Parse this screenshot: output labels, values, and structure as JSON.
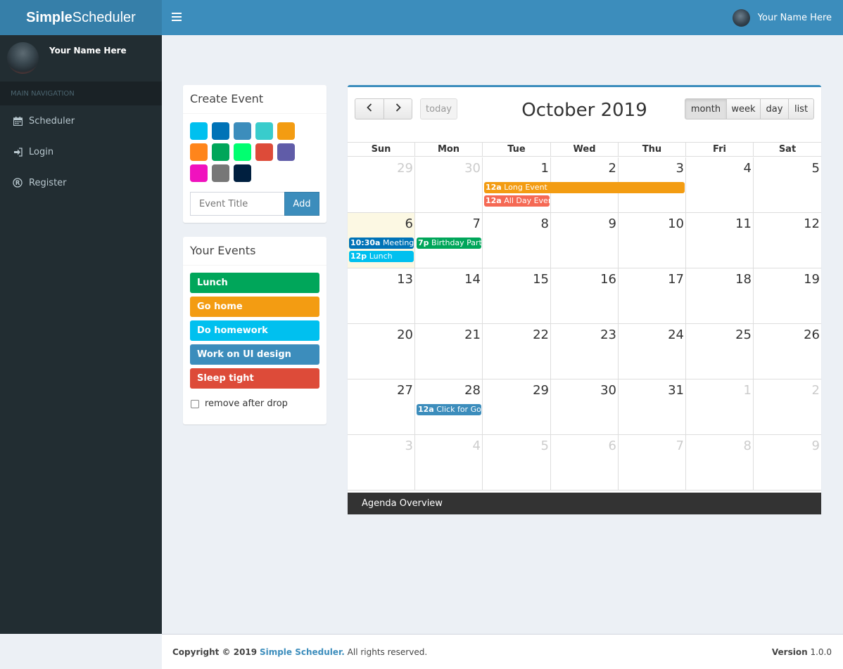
{
  "header": {
    "logo_bold": "Simple",
    "logo_rest": "Scheduler",
    "user_name": "Your Name Here"
  },
  "sidebar": {
    "user_name": "Your Name Here",
    "nav_header": "MAIN NAVIGATION",
    "items": [
      {
        "label": "Scheduler",
        "icon": "calendar-icon"
      },
      {
        "label": "Login",
        "icon": "sign-in-icon"
      },
      {
        "label": "Register",
        "icon": "registered-icon"
      }
    ]
  },
  "create_event": {
    "title": "Create Event",
    "colors": [
      "#00c0ef",
      "#0073b7",
      "#3c8dbc",
      "#39cccc",
      "#f39c12",
      "#ff851b",
      "#00a65a",
      "#01ff70",
      "#dd4b39",
      "#605ca8",
      "#f012be",
      "#777777",
      "#001f3f"
    ],
    "input_placeholder": "Event Title",
    "add_label": "Add"
  },
  "your_events": {
    "title": "Your Events",
    "items": [
      {
        "label": "Lunch",
        "color": "#00a65a"
      },
      {
        "label": "Go home",
        "color": "#f39c12"
      },
      {
        "label": "Do homework",
        "color": "#00c0ef"
      },
      {
        "label": "Work on UI design",
        "color": "#3c8dbc"
      },
      {
        "label": "Sleep tight",
        "color": "#dd4b39"
      }
    ],
    "remove_label": "remove after drop"
  },
  "calendar": {
    "title": "October 2019",
    "today_label": "today",
    "views": [
      "month",
      "week",
      "day",
      "list"
    ],
    "active_view": "month",
    "days_of_week": [
      "Sun",
      "Mon",
      "Tue",
      "Wed",
      "Thu",
      "Fri",
      "Sat"
    ],
    "weeks": [
      [
        {
          "n": "29",
          "o": true
        },
        {
          "n": "30",
          "o": true
        },
        {
          "n": "1"
        },
        {
          "n": "2"
        },
        {
          "n": "3"
        },
        {
          "n": "4"
        },
        {
          "n": "5"
        }
      ],
      [
        {
          "n": "6",
          "today": true
        },
        {
          "n": "7"
        },
        {
          "n": "8"
        },
        {
          "n": "9"
        },
        {
          "n": "10"
        },
        {
          "n": "11"
        },
        {
          "n": "12"
        }
      ],
      [
        {
          "n": "13"
        },
        {
          "n": "14"
        },
        {
          "n": "15"
        },
        {
          "n": "16"
        },
        {
          "n": "17"
        },
        {
          "n": "18"
        },
        {
          "n": "19"
        }
      ],
      [
        {
          "n": "20"
        },
        {
          "n": "21"
        },
        {
          "n": "22"
        },
        {
          "n": "23"
        },
        {
          "n": "24"
        },
        {
          "n": "25"
        },
        {
          "n": "26"
        }
      ],
      [
        {
          "n": "27"
        },
        {
          "n": "28"
        },
        {
          "n": "29"
        },
        {
          "n": "30"
        },
        {
          "n": "31"
        },
        {
          "n": "1",
          "o": true
        },
        {
          "n": "2",
          "o": true
        }
      ],
      [
        {
          "n": "3",
          "o": true
        },
        {
          "n": "4",
          "o": true
        },
        {
          "n": "5",
          "o": true
        },
        {
          "n": "6",
          "o": true
        },
        {
          "n": "7",
          "o": true
        },
        {
          "n": "8",
          "o": true
        },
        {
          "n": "9",
          "o": true
        }
      ]
    ],
    "events": [
      {
        "week": 0,
        "start": 2,
        "span": 3,
        "slot": 0,
        "time": "12a",
        "title": "Long Event",
        "color": "#f39c12"
      },
      {
        "week": 0,
        "start": 2,
        "span": 1,
        "slot": 1,
        "time": "12a",
        "title": "All Day Event",
        "color": "#f56954"
      },
      {
        "week": 1,
        "start": 0,
        "span": 1,
        "slot": 0,
        "time": "10:30a",
        "title": "Meeting",
        "color": "#0073b7"
      },
      {
        "week": 1,
        "start": 0,
        "span": 1,
        "slot": 1,
        "time": "12p",
        "title": "Lunch",
        "color": "#00c0ef"
      },
      {
        "week": 1,
        "start": 1,
        "span": 1,
        "slot": 0,
        "time": "7p",
        "title": "Birthday Party",
        "color": "#00a65a"
      },
      {
        "week": 4,
        "start": 1,
        "span": 1,
        "slot": 0,
        "time": "12a",
        "title": "Click for Goog",
        "color": "#3c8dbc"
      }
    ],
    "agenda_label": "Agenda Overview"
  },
  "footer": {
    "copyright": "Copyright © 2019",
    "brand": "Simple Scheduler.",
    "rights": "All rights reserved.",
    "version_label": "Version",
    "version": "1.0.0"
  }
}
